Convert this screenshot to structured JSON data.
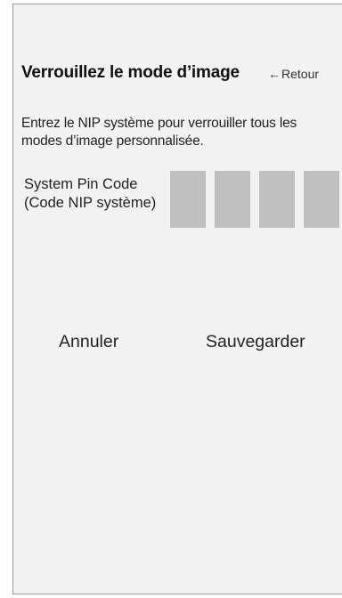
{
  "header": {
    "title": "Verrouillez le mode d’image",
    "back_arrow": "←",
    "back_label": "Retour"
  },
  "description": "Entrez le NIP système pour verrouiller tous les modes d’image personnalisée.",
  "pin": {
    "label": "System Pin Code (Code NIP système)",
    "digits": [
      "",
      "",
      "",
      ""
    ]
  },
  "actions": {
    "cancel_label": "Annuler",
    "save_label": "Sauvegarder"
  },
  "colors": {
    "panel_background": "#f2f2f2",
    "pin_box": "#c0c0c0",
    "border": "#9a9a9a"
  }
}
